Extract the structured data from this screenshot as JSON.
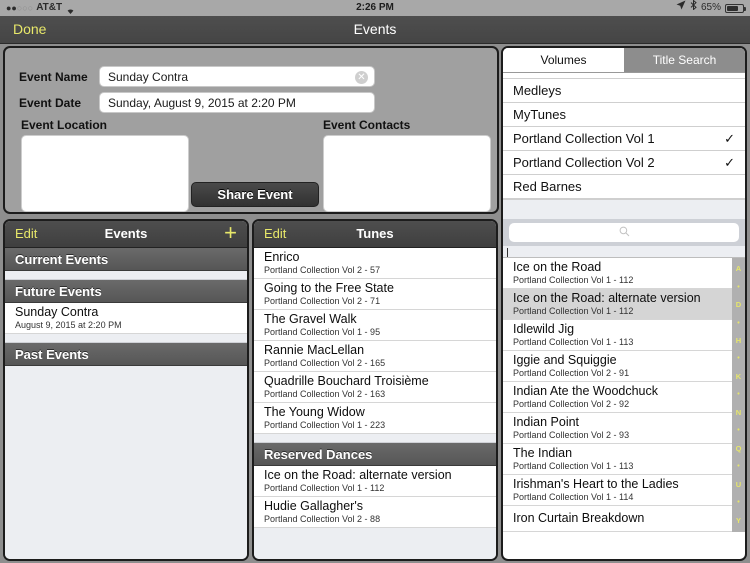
{
  "statusbar": {
    "carrier": "AT&T",
    "signal_filled": 2,
    "signal_total": 5,
    "time": "2:26 PM",
    "battery_percent": "65%",
    "icons": [
      "location-arrow-icon",
      "bluetooth-icon",
      "battery-icon",
      "wifi-icon"
    ]
  },
  "navbar": {
    "done_label": "Done",
    "title": "Events"
  },
  "form": {
    "name_label": "Event Name",
    "name_value": "Sunday Contra",
    "clear_icon": "✕",
    "date_label": "Event Date",
    "date_value": "Sunday, August 9, 2015 at 2:20 PM",
    "location_label": "Event Location",
    "location_value": "",
    "contacts_label": "Event Contacts",
    "contacts_value": "",
    "share_label": "Share Event"
  },
  "events_panel": {
    "edit_label": "Edit",
    "title": "Events",
    "add_label": "+",
    "sections": [
      {
        "header": "Current Events",
        "rows": []
      },
      {
        "header": "Future Events",
        "rows": [
          {
            "title": "Sunday Contra",
            "sub": "August 9, 2015 at 2:20 PM"
          }
        ]
      },
      {
        "header": "Past Events",
        "rows": []
      }
    ]
  },
  "tunes_panel": {
    "edit_label": "Edit",
    "title": "Tunes",
    "rows": [
      {
        "title": "Enrico",
        "sub": "Portland Collection Vol 2 - 57"
      },
      {
        "title": "Going to the Free State",
        "sub": "Portland Collection Vol 2 - 71"
      },
      {
        "title": "The Gravel Walk",
        "sub": "Portland Collection Vol 1 - 95"
      },
      {
        "title": "Rannie MacLellan",
        "sub": "Portland Collection Vol 2 - 165"
      },
      {
        "title": "Quadrille Bouchard Troisième",
        "sub": "Portland Collection Vol 2 - 163"
      },
      {
        "title": "The Young Widow",
        "sub": "Portland Collection Vol 1 - 223"
      }
    ],
    "reserved_header": "Reserved Dances",
    "reserved_rows": [
      {
        "title": "Ice on the Road: alternate version",
        "sub": "Portland Collection Vol 1 - 112"
      },
      {
        "title": "Hudie Gallagher's",
        "sub": "Portland Collection Vol 2 - 88"
      }
    ]
  },
  "right_panel": {
    "tabs": [
      {
        "label": "Volumes",
        "active": true
      },
      {
        "label": "Title Search",
        "active": false
      }
    ],
    "volumes": [
      {
        "name": "",
        "checked": false,
        "clipped": true
      },
      {
        "name": "Medleys",
        "checked": false
      },
      {
        "name": "MyTunes",
        "checked": false
      },
      {
        "name": "Portland Collection Vol 1",
        "checked": true
      },
      {
        "name": "Portland Collection Vol 2",
        "checked": true
      },
      {
        "name": "Red Barnes",
        "checked": false
      }
    ],
    "check_glyph": "✓",
    "search": {
      "placeholder": "",
      "value": "",
      "icon": "search-icon"
    },
    "tunes": [
      {
        "title": "Ice on the Road",
        "sub": "Portland Collection Vol 1 - 112",
        "selected": false
      },
      {
        "title": "Ice on the Road: alternate version",
        "sub": "Portland Collection Vol 1 - 112",
        "selected": true
      },
      {
        "title": "Idlewild Jig",
        "sub": "Portland Collection Vol 1 - 113",
        "selected": false
      },
      {
        "title": "Iggie and Squiggie",
        "sub": "Portland Collection Vol 2 - 91",
        "selected": false
      },
      {
        "title": "Indian Ate the Woodchuck",
        "sub": "Portland Collection Vol 2 - 92",
        "selected": false
      },
      {
        "title": "Indian Point",
        "sub": "Portland Collection Vol 2 - 93",
        "selected": false
      },
      {
        "title": "The Indian",
        "sub": "Portland Collection Vol 1 - 113",
        "selected": false
      },
      {
        "title": "Irishman's Heart to the Ladies",
        "sub": "Portland Collection Vol 1 - 114",
        "selected": false
      },
      {
        "title": "Iron Curtain Breakdown",
        "sub": "",
        "selected": false
      }
    ],
    "index_bar": [
      "A",
      "•",
      "D",
      "•",
      "H",
      "•",
      "K",
      "•",
      "N",
      "•",
      "Q",
      "•",
      "U",
      "•",
      "Y"
    ]
  },
  "colors": {
    "accent_yellow": "#e8e86a",
    "navbar_gray": "#4a4a4a",
    "section_header_gray": "#5e5e5e",
    "panel_bg": "#a0a0a0",
    "list_bg": "#eceef2",
    "selected_row": "#d5d5d5"
  }
}
